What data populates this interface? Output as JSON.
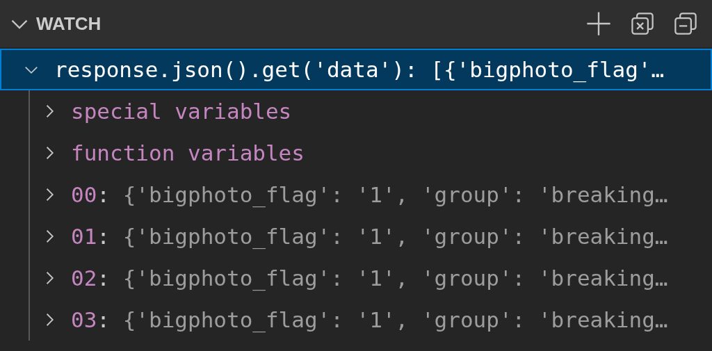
{
  "panel": {
    "title": "WATCH",
    "expanded": true
  },
  "expressions": [
    {
      "expression": "response.json().get('data')",
      "separator": ": ",
      "value": "[{'bigphoto_flag'…",
      "expanded": true,
      "selected": true,
      "children": [
        {
          "kind": "group",
          "label": "special variables",
          "expanded": false
        },
        {
          "kind": "group",
          "label": "function variables",
          "expanded": false
        },
        {
          "kind": "item",
          "name": "00",
          "separator": ": ",
          "value": "{'bigphoto_flag': '1', 'group': 'breaking…",
          "expanded": false
        },
        {
          "kind": "item",
          "name": "01",
          "separator": ": ",
          "value": "{'bigphoto_flag': '1', 'group': 'breaking…",
          "expanded": false
        },
        {
          "kind": "item",
          "name": "02",
          "separator": ": ",
          "value": "{'bigphoto_flag': '1', 'group': 'breaking…",
          "expanded": false
        },
        {
          "kind": "item",
          "name": "03",
          "separator": ": ",
          "value": "{'bigphoto_flag': '1', 'group': 'breaking…",
          "expanded": false
        }
      ]
    }
  ]
}
